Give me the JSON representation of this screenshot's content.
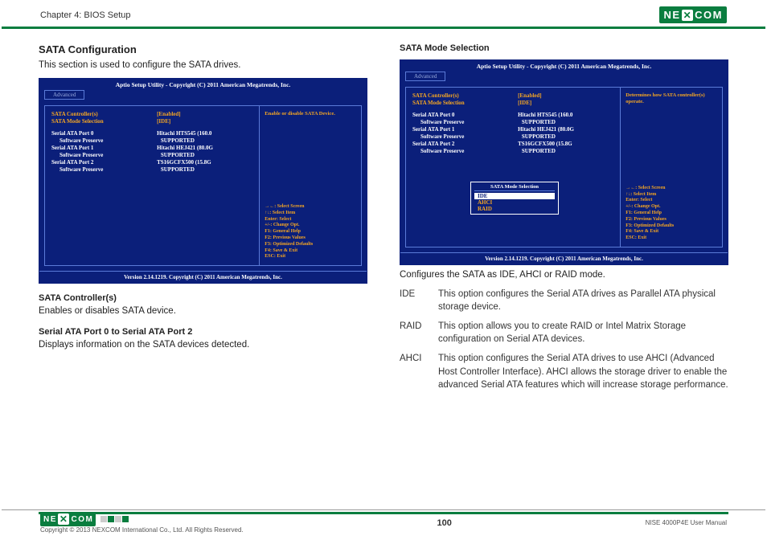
{
  "header": {
    "chapter": "Chapter 4: BIOS Setup",
    "brand": "NEXCOM"
  },
  "left": {
    "title": "SATA Configuration",
    "intro": "This section is used to configure the SATA drives.",
    "sub1_title": "SATA Controller(s)",
    "sub1_body": "Enables or disables SATA device.",
    "sub2_title": "Serial ATA Port 0 to Serial ATA Port 2",
    "sub2_body": "Displays information on the SATA devices detected."
  },
  "right": {
    "title": "SATA Mode Selection",
    "desc": "Configures the SATA as IDE, AHCI or RAID mode.",
    "modes": {
      "ide_label": "IDE",
      "ide_text": "This option configures the Serial ATA drives as Parallel ATA physical  storage device.",
      "raid_label": "RAID",
      "raid_text": "This option allows you to create RAID or Intel Matrix Storage configuration on Serial ATA devices.",
      "ahci_label": "AHCI",
      "ahci_text": "This option configures the Serial ATA drives to use AHCI (Advanced Host Controller Interface). AHCI allows the storage driver to enable the advanced Serial ATA features which will increase storage performance."
    }
  },
  "bios": {
    "title": "Aptio Setup Utility - Copyright (C) 2011 American Megatrends, Inc.",
    "tab": "Advanced",
    "row_ctrl_label": "SATA Controller(s)",
    "row_ctrl_val": "[Enabled]",
    "row_mode_label": "SATA Mode Selection",
    "row_mode_val": "[IDE]",
    "p0_label": "Serial ATA Port 0",
    "p0_val": "Hitachi HTS545    (160.0",
    "p0_sw_label": "Software Preserve",
    "p0_sw_val": "SUPPORTED",
    "p1_label": "Serial ATA Port 1",
    "p1_val": "Hitachi HEJ421    (80.0G",
    "p1_sw_label": "Software Preserve",
    "p1_sw_val": "SUPPORTED",
    "p2_label": "Serial ATA Port 2",
    "p2_val": "TS16GCFX500     (15.8G",
    "p2_sw_label": "Software Preserve",
    "p2_sw_val": "SUPPORTED",
    "help1": "Enable or disable SATA Device.",
    "help2": "Determines how SATA controller(s) operate.",
    "nav": "→←: Select Screen\n↑↓: Select Item\nEnter: Select\n+/-: Change Opt.\nF1: General Help\nF2: Previous Values\nF3: Optimized Defaults\nF4: Save & Exit\nESC: Exit",
    "version": "Version 2.14.1219. Copyright (C) 2011 American Megatrends, Inc.",
    "popup_title": "SATA Mode Selection",
    "popup_ide": "IDE",
    "popup_ahci": "AHCI",
    "popup_raid": "RAID"
  },
  "footer": {
    "copyright": "Copyright © 2013 NEXCOM International Co., Ltd. All Rights Reserved.",
    "page": "100",
    "manual": "NISE 4000P4E User Manual"
  }
}
